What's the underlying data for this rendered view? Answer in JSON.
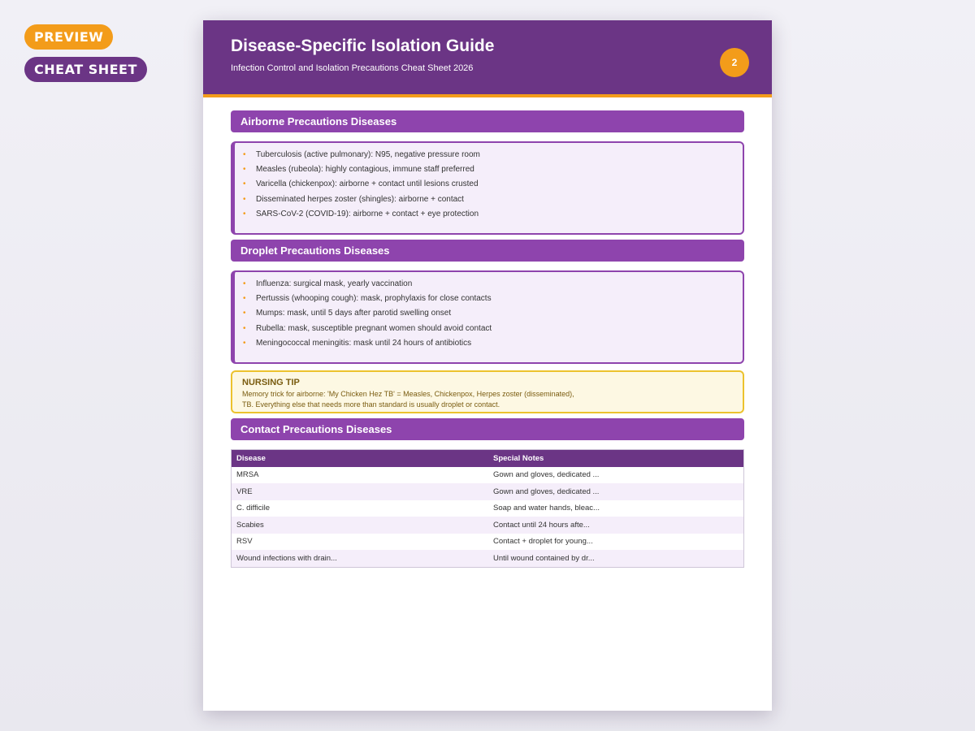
{
  "badges": {
    "preview": "PREVIEW",
    "cheat_sheet": "CHEAT SHEET"
  },
  "header": {
    "title": "Disease-Specific Isolation Guide",
    "subtitle": "Infection Control and Isolation Precautions Cheat Sheet 2026",
    "page_number": "2"
  },
  "colors": {
    "primary": "#6b3585",
    "section": "#8e44ad",
    "accent": "#f39c1a",
    "tip_border": "#ecc22e"
  },
  "sections": {
    "airborne": {
      "title": "Airborne Precautions Diseases",
      "items": [
        "Tuberculosis (active pulmonary): N95, negative pressure room",
        "Measles (rubeola): highly contagious, immune staff preferred",
        "Varicella (chickenpox): airborne + contact until lesions crusted",
        "Disseminated herpes zoster (shingles): airborne + contact",
        "SARS-CoV-2 (COVID-19): airborne + contact + eye protection"
      ]
    },
    "droplet": {
      "title": "Droplet Precautions Diseases",
      "items": [
        "Influenza: surgical mask, yearly vaccination",
        "Pertussis (whooping cough): mask, prophylaxis for close contacts",
        "Mumps: mask, until 5 days after parotid swelling onset",
        "Rubella: mask, susceptible pregnant women should avoid contact",
        "Meningococcal meningitis: mask until 24 hours of antibiotics"
      ]
    },
    "contact": {
      "title": "Contact Precautions Diseases"
    }
  },
  "tip": {
    "title": "NURSING TIP",
    "text": "Memory trick for airborne: 'My Chicken Hez TB' = Measles, Chickenpox, Herpes zoster (disseminated), TB. Everything else that needs more than standard is usually droplet or contact."
  },
  "table": {
    "headers": [
      "Disease",
      "Special Notes"
    ],
    "rows": [
      [
        "MRSA",
        "Gown and gloves, dedicated ..."
      ],
      [
        "VRE",
        "Gown and gloves, dedicated ..."
      ],
      [
        "C. difficile",
        "Soap and water hands, bleac..."
      ],
      [
        "Scabies",
        "Contact until 24 hours afte..."
      ],
      [
        "RSV",
        "Contact + droplet for young..."
      ],
      [
        "Wound infections with drain...",
        "Until wound contained by dr..."
      ]
    ]
  }
}
